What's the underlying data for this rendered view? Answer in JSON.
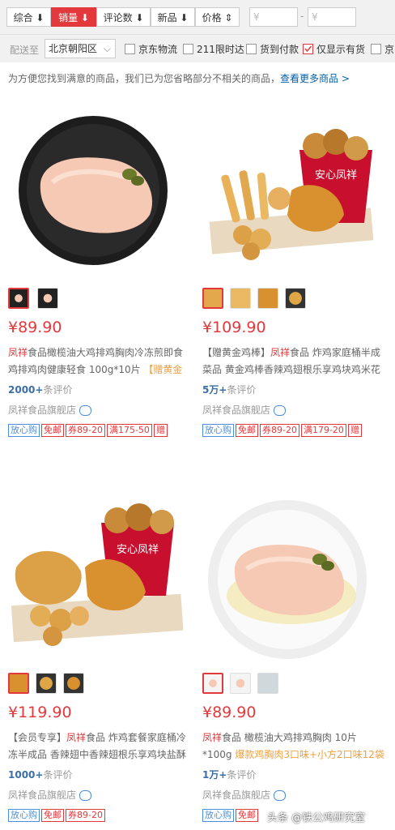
{
  "sortbar": {
    "items": [
      {
        "label": "综合 ⬇"
      },
      {
        "label": "销量 ⬇"
      },
      {
        "label": "评论数 ⬇"
      },
      {
        "label": "新品 ⬇"
      },
      {
        "label": "价格 ⇕"
      }
    ],
    "price_min_placeholder": "¥",
    "price_sep": "-",
    "price_max_placeholder": "¥"
  },
  "filter": {
    "ship_to_label": "配送至",
    "location": "北京朝阳区",
    "checkboxes": [
      {
        "label": "京东物流",
        "checked": false
      },
      {
        "label": "211限时达",
        "checked": false
      },
      {
        "label": "货到付款",
        "checked": false
      },
      {
        "label": "仅显示有货",
        "checked": true
      },
      {
        "label": "京",
        "checked": false
      }
    ]
  },
  "notice": {
    "text": "为方便您找到满意的商品，我们已为您省略部分不相关的商品，",
    "link": "查看更多商品 >"
  },
  "products": [
    {
      "price": "¥89.90",
      "title_red": "凤祥",
      "title_main": "食品橄榄油大鸡排鸡胸肉冷冻煎即食鸡排鸡肉健康轻食 100g*10片 ",
      "title_promo": "【赠黄金",
      "reviews_count": "2000+",
      "reviews_label": "条评价",
      "shop": "凤祥食品旗舰店",
      "tags": [
        "放心购",
        "免邮",
        "券89-20",
        "满175-50",
        "赠"
      ]
    },
    {
      "price": "¥109.90",
      "title_pre": "【赠黄金鸡棒】",
      "title_red": "凤祥",
      "title_main": "食品 炸鸡家庭桶半成菜品 黄金鸡棒香辣鸡翅根乐享鸡块鸡米花",
      "reviews_count": "5万+",
      "reviews_label": "条评价",
      "shop": "凤祥食品旗舰店",
      "tags": [
        "放心购",
        "免邮",
        "券89-20",
        "满179-20",
        "赠"
      ]
    },
    {
      "price": "¥119.90",
      "title_pre": "【会员专享】",
      "title_red": "凤祥",
      "title_main": "食品 炸鸡套餐家庭桶冷冻半成品 香辣翅中香辣翅根乐享鸡块盐酥",
      "reviews_count": "1000+",
      "reviews_label": "条评价",
      "shop": "凤祥食品旗舰店",
      "tags": [
        "放心购",
        "免邮",
        "券89-20"
      ]
    },
    {
      "price": "¥89.90",
      "title_red": "凤祥",
      "title_main": "食品 橄榄油大鸡排鸡胸肉 10片 *100g ",
      "title_promo": "爆款鸡胸肉3口味+小方2口味12袋",
      "reviews_count": "1万+",
      "reviews_label": "条评价",
      "shop": "凤祥食品旗舰店",
      "tags": [
        "放心购",
        "免邮"
      ]
    }
  ],
  "bucket_text": "安心凤祥",
  "watermark": "头条 @铁公鸡研究室"
}
